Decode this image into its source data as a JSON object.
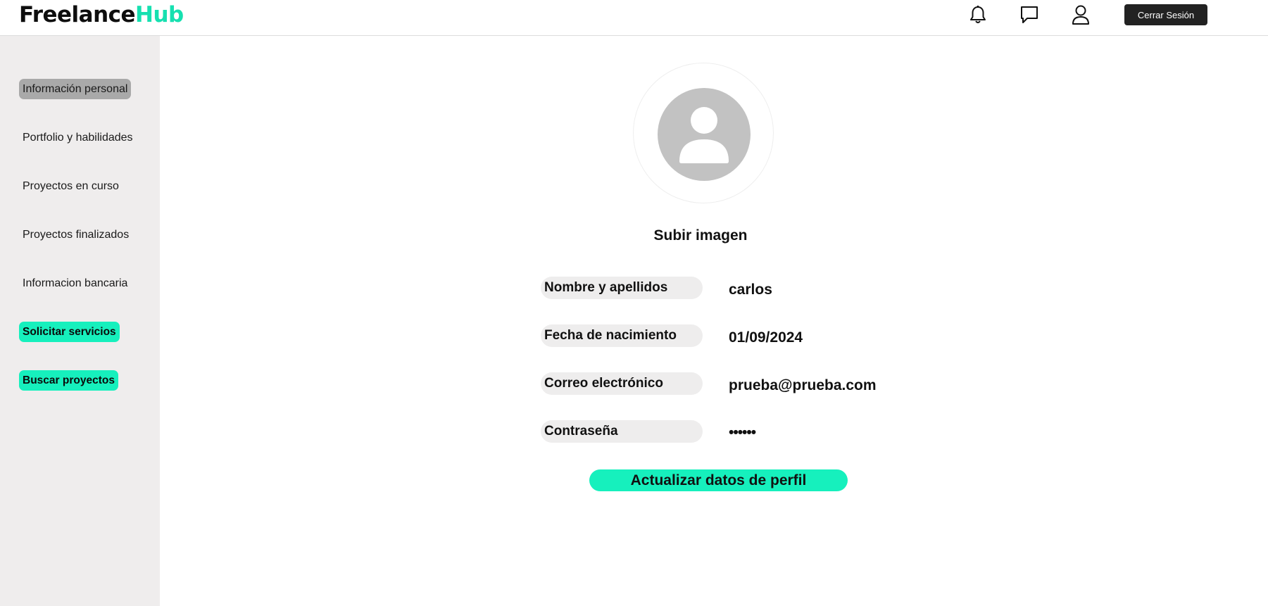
{
  "header": {
    "logo_main": "Freelance",
    "logo_accent": "Hub",
    "icons": [
      "bell-icon",
      "chat-icon",
      "user-icon"
    ],
    "logout_label": "Cerrar Sesión"
  },
  "sidebar": {
    "items": [
      {
        "label": "Información personal",
        "active": true
      },
      {
        "label": "Portfolio y habilidades"
      },
      {
        "label": "Proyectos en curso"
      },
      {
        "label": "Proyectos finalizados"
      },
      {
        "label": "Informacion bancaria"
      },
      {
        "label": "Solicitar servicios",
        "highlight": true
      },
      {
        "label": "Buscar proyectos",
        "highlight": true
      }
    ]
  },
  "profile": {
    "avatar_icon": "user-avatar-icon",
    "upload_label": "Subir imagen",
    "fields": [
      {
        "label": "Nombre y apellidos",
        "value": "carlos"
      },
      {
        "label": "Fecha de nacimiento",
        "value": "01/09/2024"
      },
      {
        "label": "Correo electrónico",
        "value": "prueba@prueba.com"
      },
      {
        "label": "Contraseña",
        "value": "••••••"
      }
    ],
    "update_label": "Actualizar datos de perfil"
  },
  "colors": {
    "accent": "#16f0bd",
    "sidebar_bg": "#efeded",
    "active_item": "#a9a9a9",
    "logout_bg": "#222222"
  }
}
